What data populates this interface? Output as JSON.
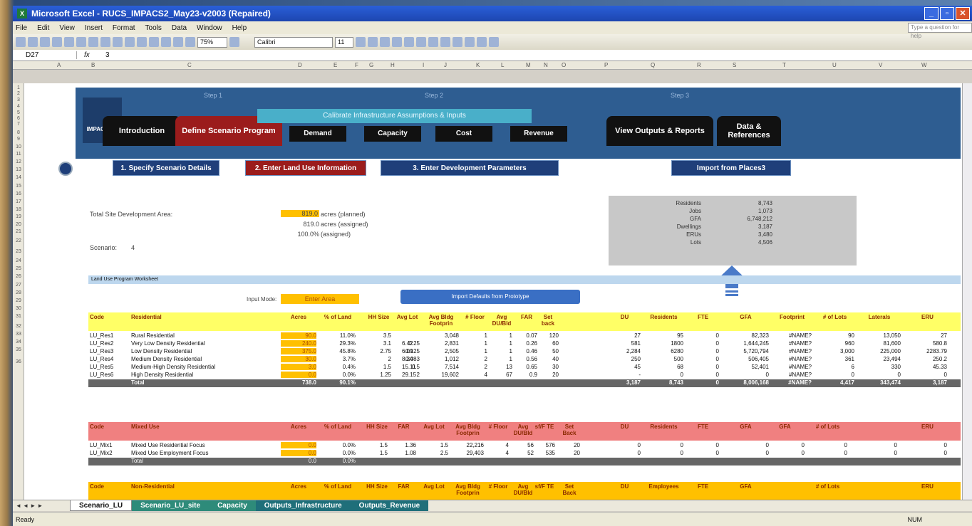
{
  "window": {
    "title": "Microsoft Excel - RUCS_IMPACS2_May23-v2003 (Repaired)"
  },
  "menu": [
    "File",
    "Edit",
    "View",
    "Insert",
    "Format",
    "Tools",
    "Data",
    "Window",
    "Help"
  ],
  "help_placeholder": "Type a question for help",
  "toolbar": {
    "zoom": "75%",
    "font": "Calibri",
    "size": "11"
  },
  "formula": {
    "name_box": "D27",
    "value": "3"
  },
  "columns": [
    "A",
    "B",
    "C",
    "D",
    "E",
    "F",
    "G",
    "H",
    "I",
    "J",
    "K",
    "L",
    "M",
    "N",
    "O",
    "P",
    "Q",
    "R",
    "S",
    "T",
    "U",
    "V",
    "W"
  ],
  "header": {
    "logo_label": "IMPACS2 .0",
    "steps": [
      "Step 1",
      "Step 2",
      "Step 3"
    ],
    "tabs": {
      "intro": "Introduction",
      "define": "Define Scenario Program",
      "calibrate": "Calibrate Infrastructure Assumptions & Inputs",
      "demand": "Demand",
      "capacity": "Capacity",
      "cost": "Cost",
      "revenue": "Revenue",
      "view": "View Outputs & Reports",
      "data": "Data & References"
    }
  },
  "subnav": {
    "b1": "1. Specify Scenario Details",
    "b2": "2. Enter Land Use Information",
    "b3": "3. Enter Development Parameters",
    "b4": "Import from Places3"
  },
  "summary": {
    "area_label": "Total Site Development Area:",
    "planned": "819.0",
    "planned_unit": "acres (planned)",
    "assigned": "819.0",
    "assigned_unit": "acres (assigned)",
    "pct": "100.0%",
    "pct_unit": "(assigned)",
    "scenario_label": "Scenario:",
    "scenario": "4"
  },
  "stats": [
    {
      "label": "Residents",
      "value": "8,743"
    },
    {
      "label": "Jobs",
      "value": "1,073"
    },
    {
      "label": "GFA",
      "value": "6,748,212"
    },
    {
      "label": "Dwellings",
      "value": "3,187"
    },
    {
      "label": "ERUs",
      "value": "3,480"
    },
    {
      "label": "Lots",
      "value": "4,506"
    }
  ],
  "worksheet_title": "Land Use Program Worksheet",
  "input_mode": {
    "label": "Input Mode:",
    "value": "Enter Area"
  },
  "import_button": "Import Defaults from Prototype",
  "res_headers": [
    "Code",
    "Residential",
    "Acres",
    "% of Land",
    "HH Size",
    "Avg Lot",
    "Avg Bldg Footprin",
    "# Floor",
    "Avg DU/Bld",
    "FAR",
    "Set back",
    "DU",
    "Residents",
    "FTE",
    "GFA",
    "Footprint",
    "# of Lots",
    "Laterals",
    "ERU"
  ],
  "res_rows": [
    [
      "LU_Res1",
      "Rural Residential",
      "90.0",
      "11.0%",
      "3.5",
      "",
      "3,048",
      "1",
      "1",
      "0.07",
      "120",
      "27",
      "95",
      "0",
      "82,323",
      "#NAME?",
      "90",
      "13,050",
      "27"
    ],
    [
      "LU_Res2",
      "Very Low Density Residential",
      "240.0",
      "29.3%",
      "3.1",
      "0.25",
      "2,831",
      "1",
      "1",
      "0.26",
      "60",
      "581",
      "1800",
      "0",
      "1,644,245",
      "#NAME?",
      "960",
      "81,600",
      "580.8"
    ],
    [
      "LU_Res3",
      "Low Density Residential",
      "375.0",
      "45.8%",
      "2.75",
      "0.125",
      "2,505",
      "1",
      "1",
      "0.46",
      "50",
      "2,284",
      "6280",
      "0",
      "5,720,794",
      "#NAME?",
      "3,000",
      "225,000",
      "2283.79"
    ],
    [
      "LU_Res4",
      "Medium Density Residential",
      "30.0",
      "3.7%",
      "2",
      "0.083",
      "1,012",
      "2",
      "1",
      "0.56",
      "40",
      "250",
      "500",
      "0",
      "506,405",
      "#NAME?",
      "361",
      "23,494",
      "250.2"
    ],
    [
      "LU_Res5",
      "Medium-High Density Residential",
      "3.0",
      "0.4%",
      "1.5",
      "0.5",
      "7,514",
      "2",
      "13",
      "0.65",
      "30",
      "45",
      "68",
      "0",
      "52,401",
      "#NAME?",
      "6",
      "330",
      "45.33"
    ],
    [
      "LU_Res6",
      "High Density Residential",
      "0.0",
      "0.0%",
      "1.25",
      "2",
      "19,602",
      "4",
      "67",
      "0.9",
      "20",
      "-",
      "0",
      "0",
      "0",
      "#NAME?",
      "0",
      "0",
      "0"
    ]
  ],
  "res_extra": [
    "",
    "",
    "6.42",
    "6.09",
    "8.34",
    "15.11",
    "29.15"
  ],
  "res_total": [
    "",
    "Total",
    "738.0",
    "90.1%",
    "",
    "",
    "",
    "",
    "",
    "",
    "",
    "3,187",
    "8,743",
    "0",
    "8,006,168",
    "#NAME?",
    "4,417",
    "343,474",
    "3,187"
  ],
  "mix_headers": [
    "Code",
    "Mixed Use",
    "Acres",
    "% of Land",
    "HH Size",
    "FAR",
    "Avg Lot",
    "Avg Bldg Footprin",
    "# Floor",
    "Avg DU/Bld",
    "sf/F TE",
    "Set Back",
    "DU",
    "Residents",
    "FTE",
    "GFA",
    "GFA",
    "# of Lots",
    "",
    "ERU"
  ],
  "mix_rows": [
    [
      "LU_Mix1",
      "Mixed Use Residential Focus",
      "0.0",
      "0.0%",
      "1.5",
      "1.36",
      "1.5",
      "22,216",
      "4",
      "56",
      "576",
      "20",
      "0",
      "0",
      "0",
      "0",
      "0",
      "0",
      "0",
      "0"
    ],
    [
      "LU_Mix2",
      "Mixed Use Employment Focus",
      "0.0",
      "0.0%",
      "1.5",
      "1.08",
      "2.5",
      "29,403",
      "4",
      "52",
      "535",
      "20",
      "0",
      "0",
      "0",
      "0",
      "0",
      "0",
      "0",
      "0"
    ]
  ],
  "mix_total": [
    "",
    "Total",
    "0.0",
    "0.0%"
  ],
  "nonres_headers": [
    "Code",
    "Non-Residential",
    "Acres",
    "% of Land",
    "HH Size",
    "FAR",
    "Avg Lot",
    "Avg Bldg Footprin",
    "# Floor",
    "Avg DU/Bld",
    "sf/F TE",
    "Set Back",
    "DU",
    "Employees",
    "FTE",
    "GFA",
    "# of Lots",
    "ERU"
  ],
  "sheet_tabs": [
    "Scenario_LU",
    "Scenario_LU_site",
    "Capacity",
    "Outputs_Infrastructure",
    "Outputs_Revenue"
  ],
  "status": {
    "ready": "Ready",
    "num": "NUM"
  },
  "row_numbers": [
    "1",
    "2",
    "3",
    "4",
    "5",
    "6",
    "7",
    "8",
    "9",
    "10",
    "11",
    "12",
    "13",
    "14",
    "15",
    "16",
    "17",
    "18",
    "19",
    "20",
    "21",
    "22",
    "23",
    "24",
    "25",
    "26",
    "27",
    "28",
    "29",
    "30",
    "31",
    "32",
    "33",
    "34",
    "35",
    "36"
  ]
}
